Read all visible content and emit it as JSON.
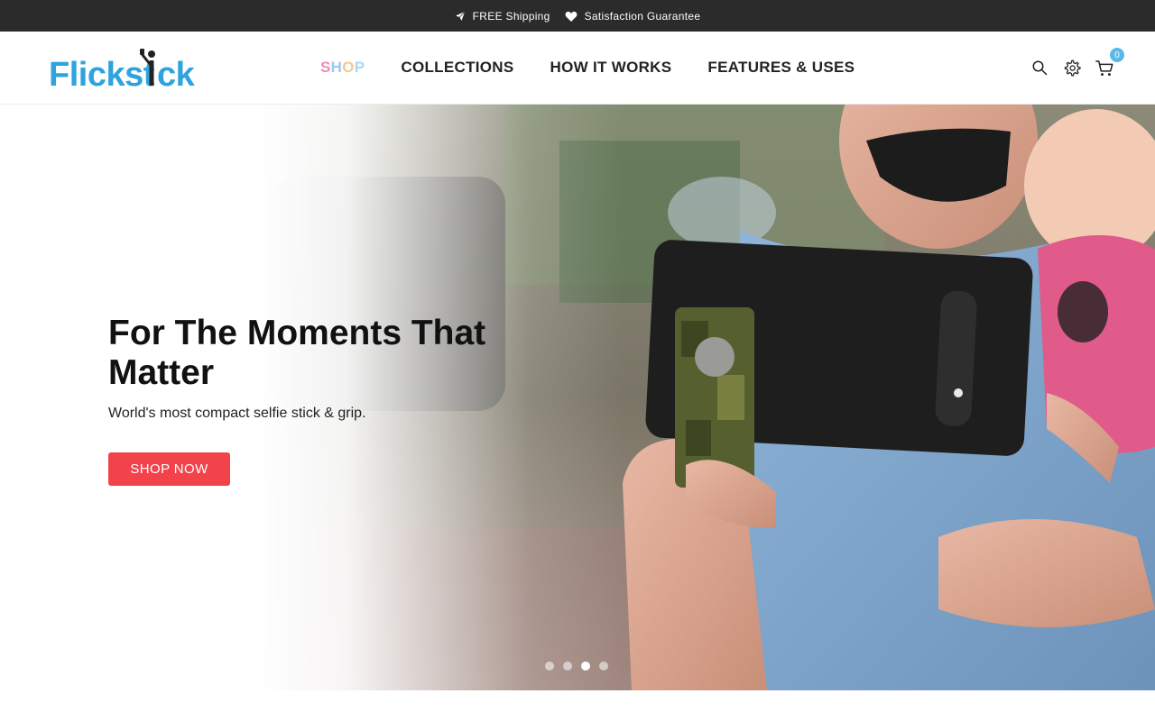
{
  "topbar": {
    "promos": [
      {
        "icon": "paper-plane-icon",
        "text": "FREE Shipping"
      },
      {
        "icon": "heart-icon",
        "text": "Satisfaction Guarantee"
      }
    ]
  },
  "header": {
    "logo_text": "Flickstick",
    "nav": [
      {
        "label": "SHOP"
      },
      {
        "label": "COLLECTIONS"
      },
      {
        "label": "HOW IT WORKS"
      },
      {
        "label": "FEATURES & USES"
      }
    ],
    "icons": [
      "search-icon",
      "gear-icon",
      "cart-icon"
    ],
    "cart_count": "0"
  },
  "hero": {
    "title": "For The Moments That Matter",
    "subtitle": "World's most compact selfie stick & grip.",
    "button_label": "SHOP NOW",
    "slides": 4,
    "active_slide": 3
  },
  "colors": {
    "topbar_bg": "#2b2b2b",
    "logo_blue": "#2ea3dd",
    "button_red": "#f2434b",
    "cart_badge": "#5bb8e8"
  }
}
